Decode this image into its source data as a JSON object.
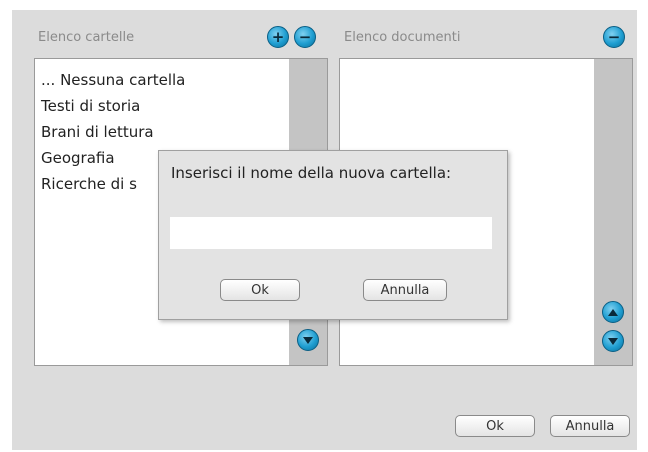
{
  "folders_panel": {
    "title": "Elenco cartelle",
    "add_glyph": "+",
    "remove_glyph": "−",
    "items": [
      "... Nessuna cartella",
      "Testi di storia",
      "Brani di lettura",
      "Geografia",
      "Ricerche di s"
    ]
  },
  "documents_panel": {
    "title": "Elenco documenti",
    "remove_glyph": "−"
  },
  "dialog": {
    "prompt": "Inserisci il nome della nuova cartella:",
    "input_value": "",
    "ok_label": "Ok",
    "cancel_label": "Annulla"
  },
  "footer": {
    "ok_label": "Ok",
    "cancel_label": "Annulla"
  },
  "colors": {
    "accent": "#1f9ed1",
    "window_bg": "#dcdcdc",
    "scrollbar": "#c4c4c4"
  }
}
